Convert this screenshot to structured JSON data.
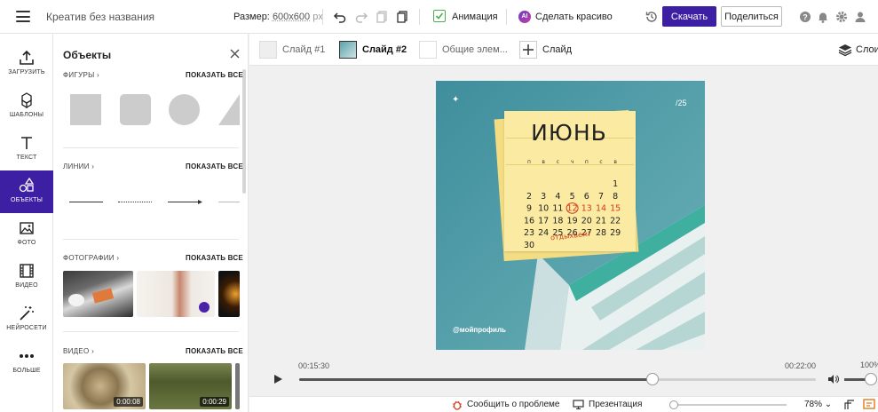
{
  "header": {
    "title": "Креатив без названия",
    "size_label": "Размер:",
    "size_value": "600x600",
    "size_unit": "px",
    "animation_label": "Анимация",
    "ai_badge": "AI",
    "beautify_label": "Сделать красиво",
    "download_label": "Скачать",
    "share_label": "Поделиться"
  },
  "rail": {
    "items": [
      {
        "label": "ЗАГРУЗИТЬ",
        "icon": "upload-icon"
      },
      {
        "label": "ШАБЛОНЫ",
        "icon": "templates-icon"
      },
      {
        "label": "ТЕКСТ",
        "icon": "text-icon"
      },
      {
        "label": "ОБЪЕКТЫ",
        "icon": "objects-icon",
        "active": true
      },
      {
        "label": "ФОТО",
        "icon": "photo-icon"
      },
      {
        "label": "ВИДЕО",
        "icon": "video-icon"
      },
      {
        "label": "НЕЙРОСЕТИ",
        "icon": "magic-wand-icon"
      },
      {
        "label": "БОЛЬШЕ",
        "icon": "more-icon"
      }
    ]
  },
  "panel": {
    "title": "Объекты",
    "show_all": "ПОКАЗАТЬ ВСЕ",
    "sections": {
      "shapes": "ФИГУРЫ",
      "lines": "ЛИНИИ",
      "photos": "ФОТОГРАФИИ",
      "video": "ВИДЕО"
    },
    "video_durations": [
      "0:00:08",
      "0:00:29"
    ]
  },
  "slides": {
    "tabs": [
      {
        "label": "Слайд #1",
        "active": false
      },
      {
        "label": "Слайд #2",
        "active": true
      },
      {
        "label": "Общие элем...",
        "active": false
      }
    ],
    "add_label": "Слайд",
    "layers_label": "Слои"
  },
  "canvas": {
    "counter": "/25",
    "month": "ИЮНЬ",
    "weekdays": [
      "п",
      "в",
      "с",
      "ч",
      "п",
      "с",
      "в"
    ],
    "weeks": [
      [
        "",
        "",
        "",
        "",
        "",
        "",
        "1"
      ],
      [
        "2",
        "3",
        "4",
        "5",
        "6",
        "7",
        "8"
      ],
      [
        "9",
        "10",
        "11",
        "12",
        "13",
        "14",
        "15"
      ],
      [
        "16",
        "17",
        "18",
        "19",
        "20",
        "21",
        "22"
      ],
      [
        "23",
        "24",
        "25",
        "26",
        "27",
        "28",
        "29"
      ],
      [
        "30",
        "",
        "",
        "",
        "",
        "",
        ""
      ]
    ],
    "rest_note": "отдыхаем!",
    "handle": "@мойпрофиль",
    "colors": {
      "bg": "#4f9aa6",
      "note": "#fbeaa2",
      "red": "#d23c1d"
    }
  },
  "timeline": {
    "current": "00:15:30",
    "total": "00:22:00",
    "volume": "100%",
    "progress": 0.684,
    "volume_level": 1.0
  },
  "footer": {
    "report": "Сообщить о проблеме",
    "presentation": "Презентация",
    "zoom": "78%"
  }
}
